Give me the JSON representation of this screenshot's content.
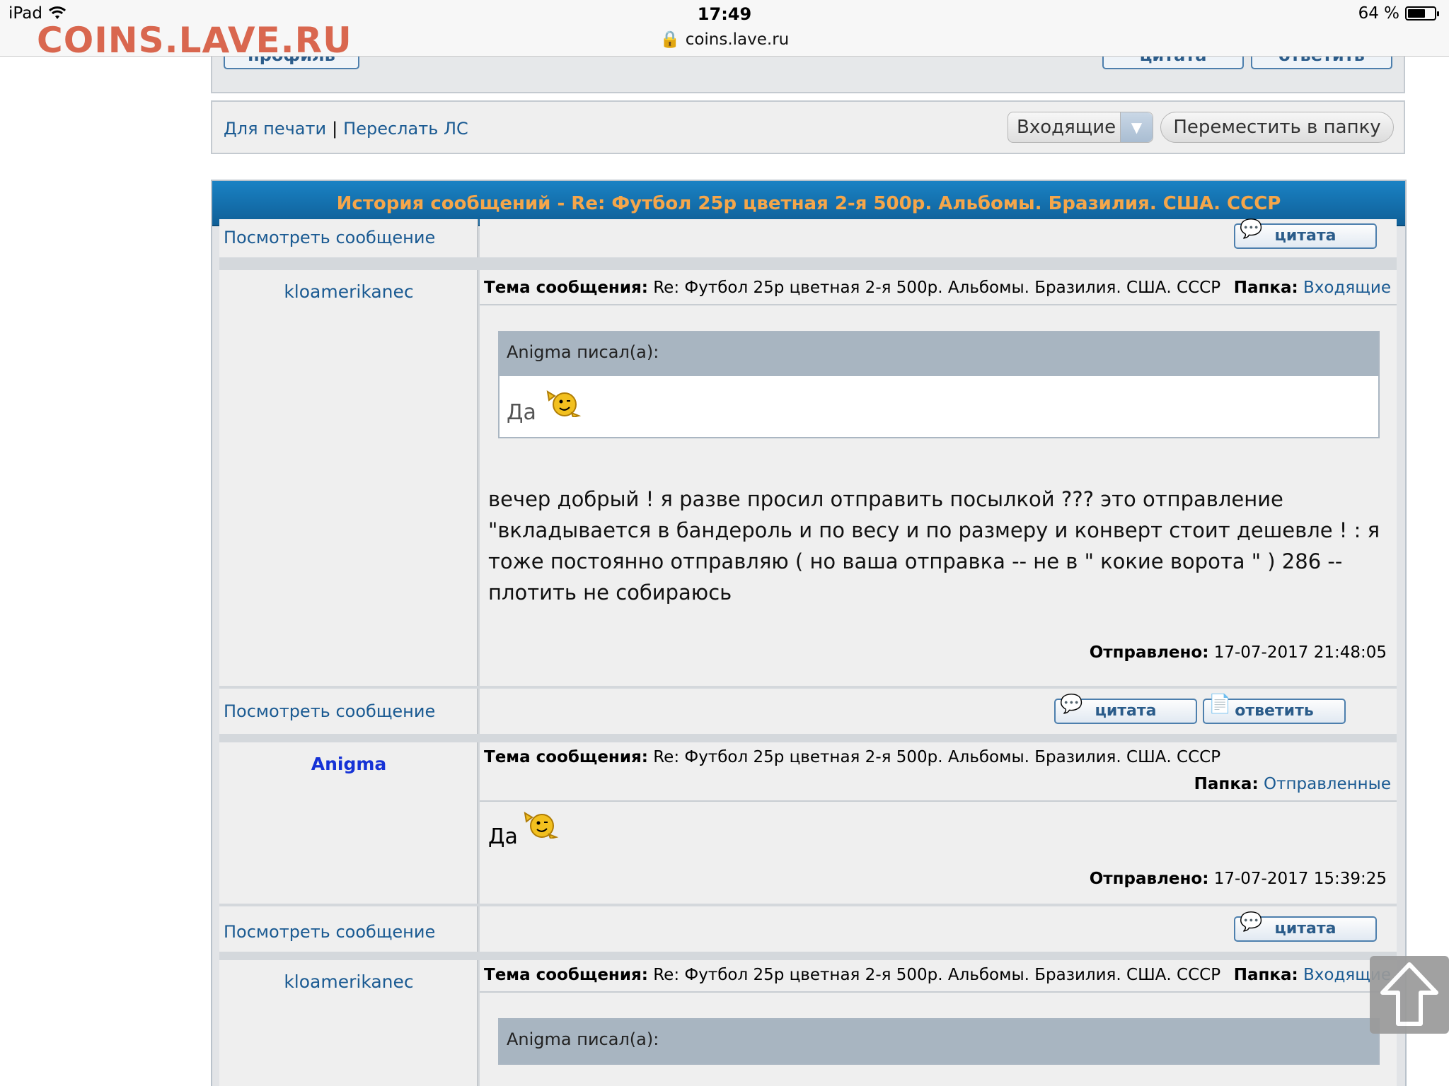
{
  "status": {
    "device": "iPad",
    "time": "17:49",
    "url": "coins.lave.ru",
    "battery": "64 %",
    "battery_level": 0.64
  },
  "watermark": "COINS.LAVE.RU",
  "top_buttons": {
    "profile": "профиль",
    "quote": "цитата",
    "reply": "ответить"
  },
  "print_bar": {
    "print": "Для печати",
    "separator": "|",
    "forward": "Переслать ЛС",
    "folder_select": "Входящие",
    "move": "Переместить в папку"
  },
  "history": {
    "title": "История сообщений - Re: Футбол 25р цветная 2-я 500р. Альбомы. Бразилия. США. СССР",
    "view_message": "Посмотреть сообщение",
    "subject_label": "Тема сообщения:",
    "folder_label": "Папка:",
    "sent_label": "Отправлено:",
    "quote_label": "цитата",
    "reply_label": "ответить",
    "messages": [
      {
        "author": "kloamerikanec",
        "subject": "Re: Футбол 25р цветная 2-я 500р. Альбомы. Бразилия. США. СССР",
        "folder": "Входящие",
        "quote_author": "Anigma писал(а):",
        "quote_text": "Да",
        "text": "вечер добрый ! я разве просил отправить посылкой ??? это отправление \"вкладывается в бандероль и по весу и по размеру и конверт стоит дешевле ! : я тоже постоянно отправляю ( но ваша отправка -- не в \" кокие ворота \" ) 286 -- плотить не собираюсь",
        "sent": "17-07-2017 21:48:05"
      },
      {
        "author": "Anigma",
        "subject": "Re: Футбол 25р цветная 2-я 500р. Альбомы. Бразилия. США. СССР",
        "folder": "Отправленные",
        "text": "Да",
        "sent": "17-07-2017 15:39:25"
      },
      {
        "author": "kloamerikanec",
        "subject": "Re: Футбол 25р цветная 2-я 500р. Альбомы. Бразилия. США. СССР",
        "folder": "Входящие",
        "quote_author": "Anigma писал(а):"
      }
    ]
  }
}
